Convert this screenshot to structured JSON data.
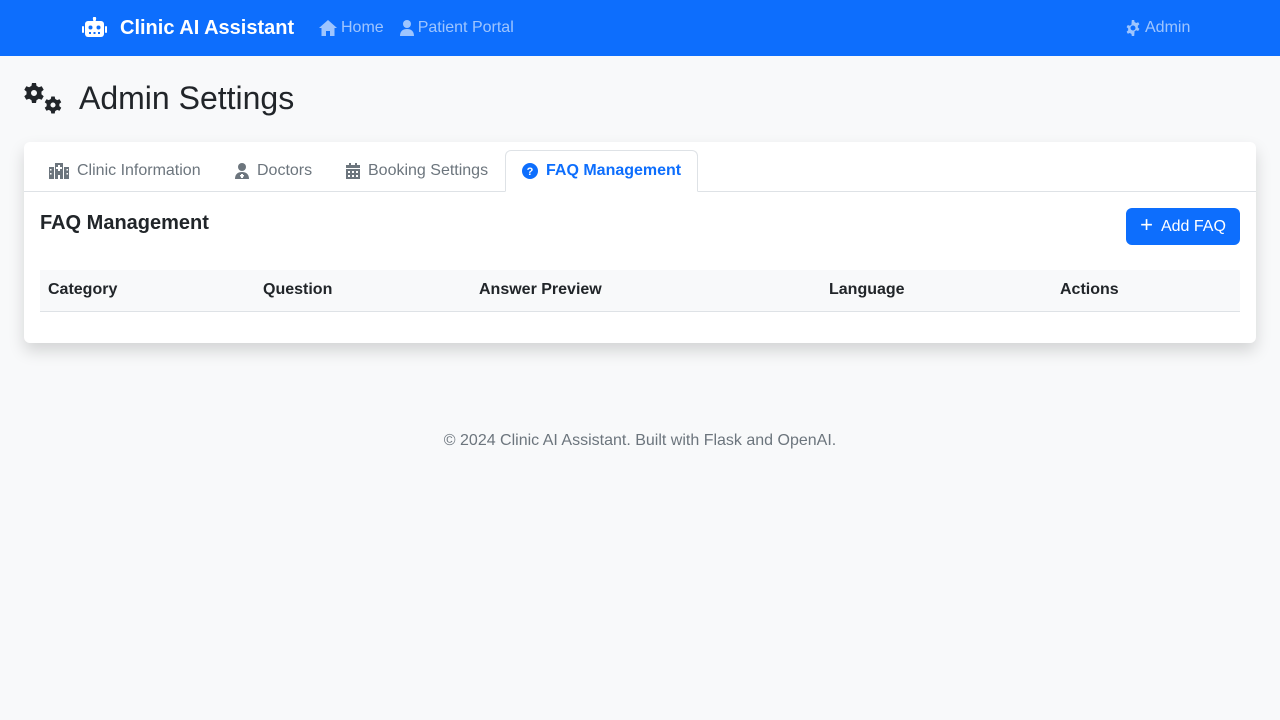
{
  "navbar": {
    "brand": "Clinic AI Assistant",
    "links": [
      {
        "label": "Home",
        "icon": "home-icon"
      },
      {
        "label": "Patient Portal",
        "icon": "user-icon"
      }
    ],
    "right_link": {
      "label": "Admin",
      "icon": "gear-icon"
    }
  },
  "page": {
    "title": "Admin Settings",
    "icon": "gears-icon"
  },
  "tabs": [
    {
      "label": "Clinic Information",
      "icon": "hospital-icon",
      "active": false
    },
    {
      "label": "Doctors",
      "icon": "doctor-icon",
      "active": false
    },
    {
      "label": "Booking Settings",
      "icon": "calendar-icon",
      "active": false
    },
    {
      "label": "FAQ Management",
      "icon": "question-circle-icon",
      "active": true
    }
  ],
  "faq": {
    "section_title": "FAQ Management",
    "add_button": "Add FAQ",
    "columns": [
      "Category",
      "Question",
      "Answer Preview",
      "Language",
      "Actions"
    ],
    "rows": []
  },
  "footer": {
    "text": "© 2024 Clinic AI Assistant. Built with Flask and OpenAI."
  },
  "colors": {
    "primary": "#0d6efd",
    "background": "#f8f9fa",
    "muted": "#6c757d"
  }
}
